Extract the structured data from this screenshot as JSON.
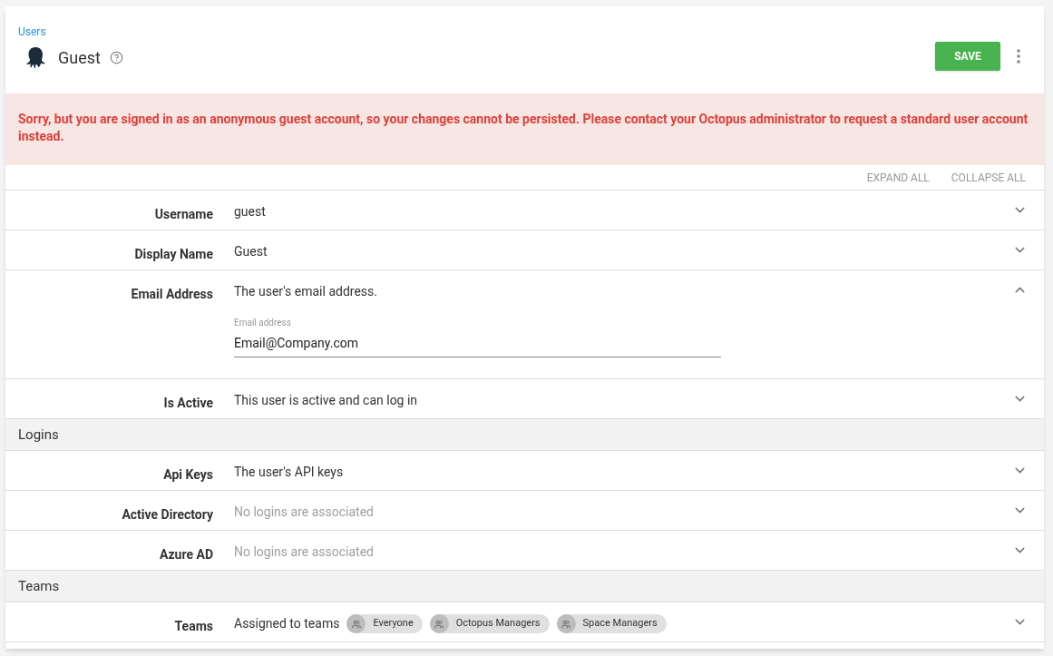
{
  "breadcrumb": "Users",
  "title": "Guest",
  "save_button": "SAVE",
  "alert": "Sorry, but you are signed in as an anonymous guest account, so your changes cannot be persisted. Please contact your Octopus administrator to request a standard user account instead.",
  "actions": [
    "EXPAND ALL",
    "COLLAPSE ALL"
  ],
  "rows": [
    {
      "kind": "row",
      "label": "Username",
      "summary": "guest",
      "muted": false,
      "expanded": false
    },
    {
      "kind": "row",
      "label": "Display Name",
      "summary": "Guest",
      "muted": false,
      "expanded": false
    },
    {
      "kind": "row",
      "label": "Email Address",
      "summary": "The user's email address.",
      "muted": false,
      "expanded": true,
      "field": {
        "label": "Email address",
        "value": "Email@Company.com"
      }
    },
    {
      "kind": "row",
      "label": "Is Active",
      "summary": "This user is active and can log in",
      "muted": false,
      "expanded": false
    },
    {
      "kind": "header",
      "label": "Logins"
    },
    {
      "kind": "row",
      "label": "Api Keys",
      "summary": "The user's API keys",
      "muted": false,
      "expanded": false
    },
    {
      "kind": "row",
      "label": "Active Directory",
      "summary": "No logins are associated",
      "muted": true,
      "expanded": false
    },
    {
      "kind": "row",
      "label": "Azure AD",
      "summary": "No logins are associated",
      "muted": true,
      "expanded": false
    },
    {
      "kind": "header",
      "label": "Teams"
    },
    {
      "kind": "row",
      "label": "Teams",
      "summary": "Assigned to teams",
      "muted": false,
      "expanded": false,
      "chips": [
        "Everyone",
        "Octopus Managers",
        "Space Managers"
      ]
    }
  ]
}
